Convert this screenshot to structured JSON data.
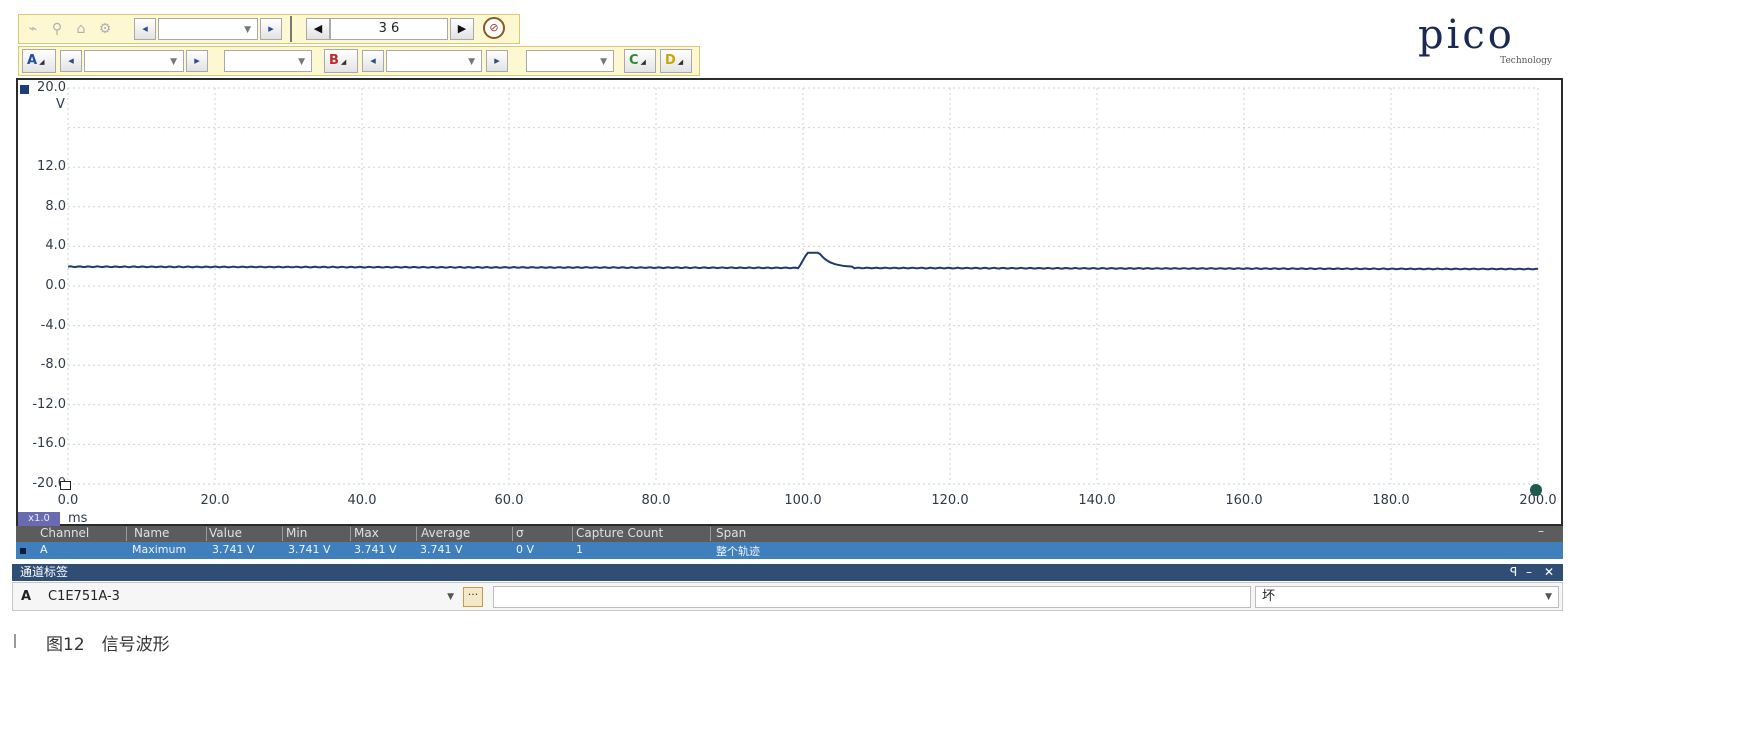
{
  "toolbar": {
    "sample_value": "3 6"
  },
  "channels": {
    "a": "A",
    "b": "B",
    "c": "C",
    "d": "D"
  },
  "logo": {
    "brand": "pico",
    "sub": "Technology"
  },
  "plot": {
    "y_unit": "V",
    "y_ticks": [
      "20.0",
      "12.0",
      "8.0",
      "4.0",
      "0.0",
      "-4.0",
      "-8.0",
      "-12.0",
      "-16.0",
      "-20.0"
    ],
    "x_ticks": [
      "0.0",
      "20.0",
      "40.0",
      "60.0",
      "80.0",
      "100.0",
      "120.0",
      "140.0",
      "160.0",
      "180.0",
      "200.0"
    ],
    "x_unit": "ms",
    "zoom": "x1.0",
    "trace_color": "#1f3a6b"
  },
  "measurements": {
    "headers": [
      "Channel",
      "Name",
      "Value",
      "Min",
      "Max",
      "Average",
      "σ",
      "Capture Count",
      "Span"
    ],
    "row": [
      "A",
      "Maximum",
      "3.741 V",
      "3.741 V",
      "3.741 V",
      "3.741 V",
      "0 V",
      "1",
      "整个轨迹"
    ]
  },
  "label_panel": {
    "title": "通道标签",
    "pin": "ꟼ",
    "minimize": "–",
    "close": "✕",
    "channel": "A",
    "channel_label": "C1E751A-3",
    "more": "···",
    "status": "坏"
  },
  "caption": "图12　信号波形"
}
